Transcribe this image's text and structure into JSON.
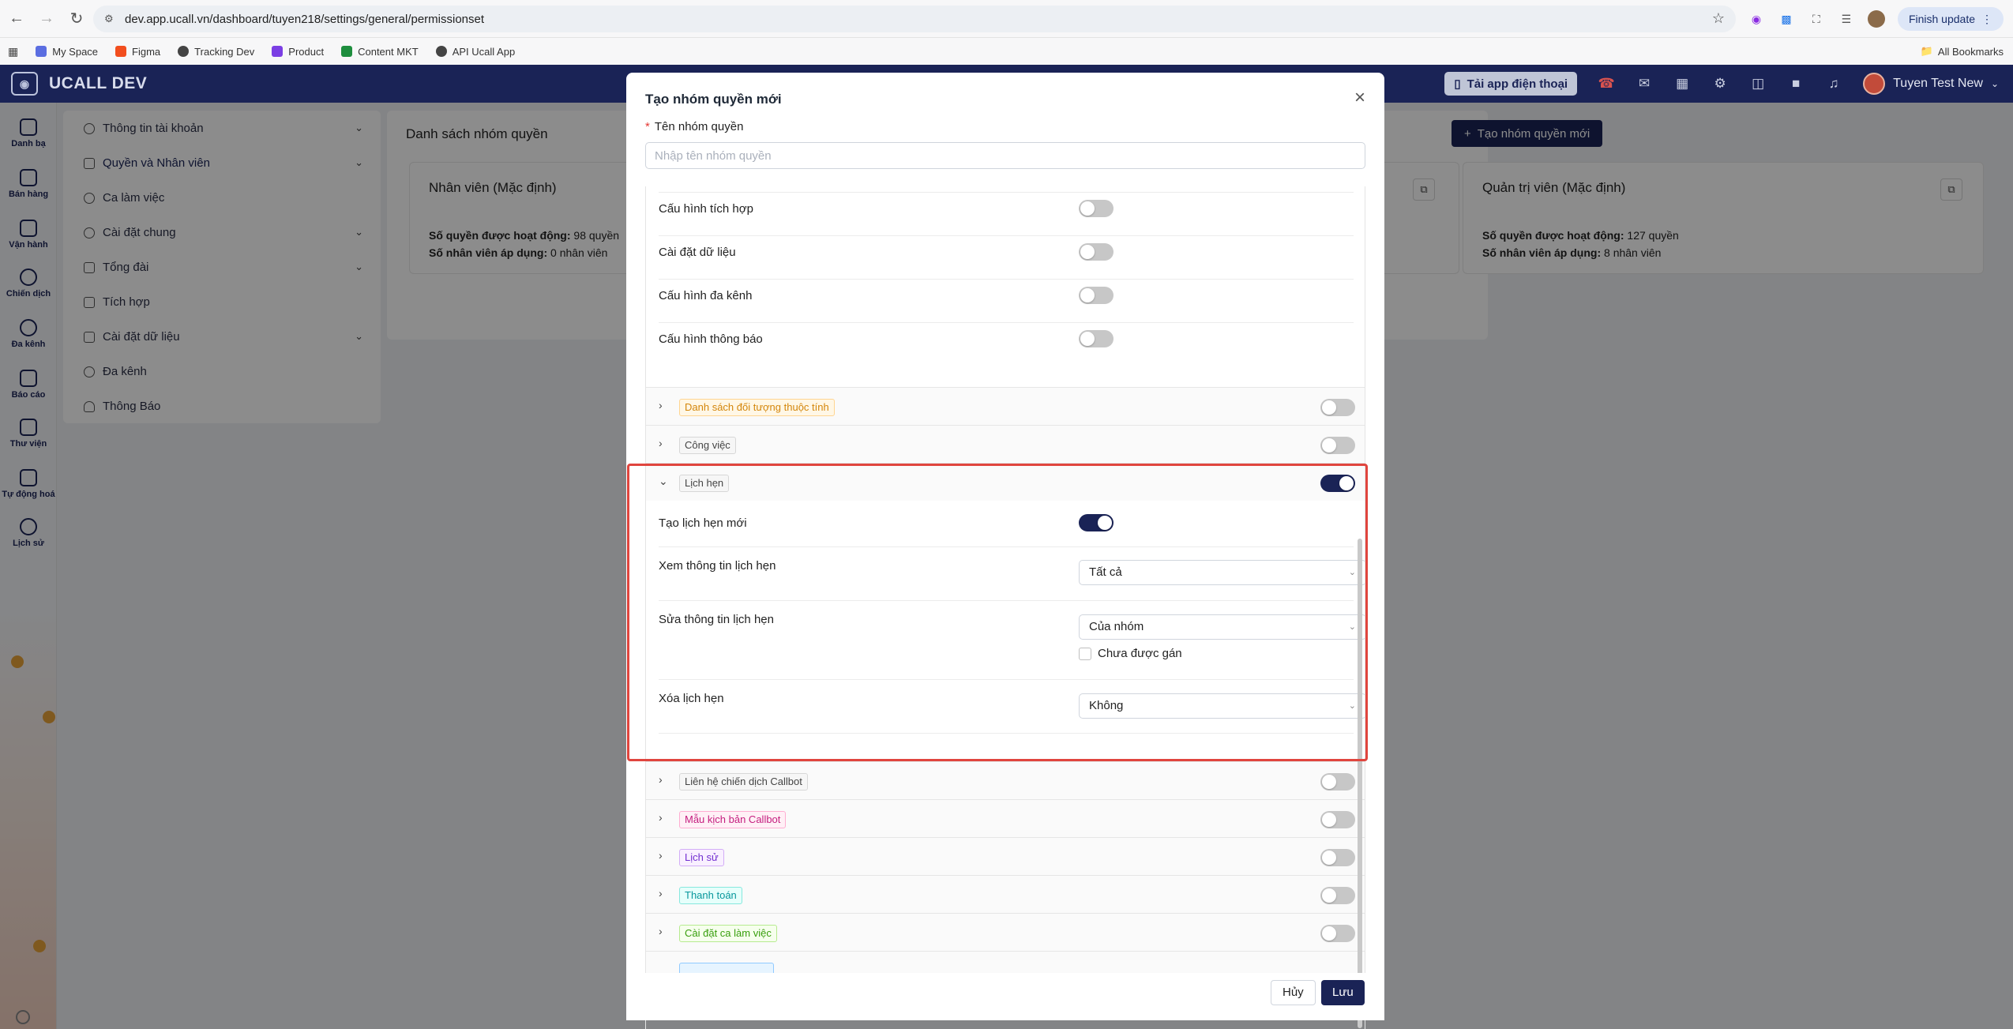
{
  "browser": {
    "url": "dev.app.ucall.vn/dashboard/tuyen218/settings/general/permissionset",
    "finish_update": "Finish update",
    "bookmarks": [
      "My Space",
      "Figma",
      "Tracking Dev",
      "Product",
      "Content MKT",
      "API Ucall App"
    ],
    "all_bookmarks": "All Bookmarks"
  },
  "header": {
    "brand": "UCALL DEV",
    "download_app": "Tải app điện thoại",
    "user_name": "Tuyen Test New"
  },
  "rail": {
    "items": [
      "Danh bạ",
      "Bán hàng",
      "Vận hành",
      "Chiến dịch",
      "Đa kênh",
      "Báo cáo",
      "Thư viện",
      "Tự động hoá",
      "Lịch sử"
    ]
  },
  "settings_menu": {
    "items": [
      "Thông tin tài khoản",
      "Quyền và Nhân viên",
      "Ca làm việc",
      "Cài đặt chung",
      "Tổng đài",
      "Tích hợp",
      "Cài đặt dữ liệu",
      "Đa kênh",
      "Thông Báo"
    ]
  },
  "page": {
    "title": "Danh sách nhóm quyền",
    "create_button": "Tạo nhóm quyền mới",
    "cards": [
      {
        "title": "Nhân viên (Mặc định)",
        "perm_label": "Số quyền được hoạt động:",
        "perm_value": "98 quyền",
        "staff_label": "Số nhân viên áp dụng:",
        "staff_value": "0 nhân viên"
      },
      {
        "title": "Quản trị viên (Mặc định)",
        "perm_label": "Số quyền được hoạt động:",
        "perm_value": "127 quyền",
        "staff_label": "Số nhân viên áp dụng:",
        "staff_value": "8 nhân viên"
      }
    ]
  },
  "modal": {
    "title": "Tạo nhóm quyền mới",
    "name_label": "Tên nhóm quyền",
    "name_placeholder": "Nhập tên nhóm quyền",
    "settings_rows": [
      "Cấu hình tích hợp",
      "Cài đặt dữ liệu",
      "Cấu hình đa kênh",
      "Cấu hình thông báo"
    ],
    "groups": [
      {
        "label": "Danh sách đối tượng thuộc tính",
        "on": false,
        "color": "orange"
      },
      {
        "label": "Công việc",
        "on": false,
        "color": "gray"
      },
      {
        "label": "Lịch hẹn",
        "on": true,
        "color": "gray"
      },
      {
        "label": "Liên hệ chiến dịch Callbot",
        "on": false,
        "color": "gray"
      },
      {
        "label": "Mẫu kịch bản Callbot",
        "on": false,
        "color": "pink"
      },
      {
        "label": "Lịch sử",
        "on": false,
        "color": "purple"
      },
      {
        "label": "Thanh toán",
        "on": false,
        "color": "cyan"
      },
      {
        "label": "Cài đặt ca làm việc",
        "on": false,
        "color": "green"
      }
    ],
    "appointment": {
      "create_label": "Tạo lịch hẹn mới",
      "create_on": true,
      "view_label": "Xem thông tin lịch hẹn",
      "view_value": "Tất cả",
      "edit_label": "Sửa thông tin lịch hẹn",
      "edit_value": "Của nhóm",
      "unassigned_label": "Chưa được gán",
      "delete_label": "Xóa lịch hẹn",
      "delete_value": "Không"
    },
    "cancel": "Hủy",
    "save": "Lưu"
  },
  "colors": {
    "primary": "#1a2356",
    "highlight": "#e0453e"
  }
}
